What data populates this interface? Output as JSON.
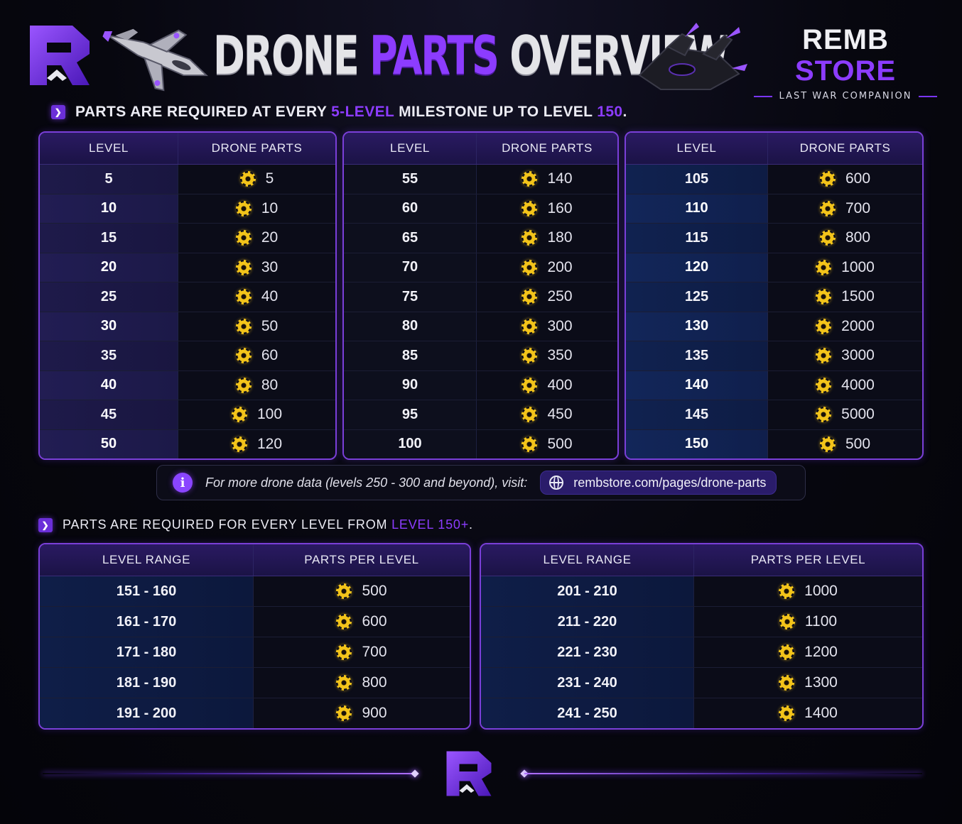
{
  "header": {
    "title_part1": "DRONE ",
    "title_part2": "PARTS",
    "title_part3": " OVERVIEW",
    "brand_part1": "REMB ",
    "brand_part2": "STORE",
    "brand_sub": "LAST WAR COMPANION"
  },
  "section1": {
    "text_a": "PARTS ARE REQUIRED AT EVERY ",
    "text_b": "5-LEVEL",
    "text_c": " MILESTONE UP TO LEVEL ",
    "text_d": "150",
    "text_e": "."
  },
  "milestone_tables": {
    "col_level": "LEVEL",
    "col_parts": "DRONE PARTS",
    "tables": [
      {
        "rows": [
          [
            "5",
            "5"
          ],
          [
            "10",
            "10"
          ],
          [
            "15",
            "20"
          ],
          [
            "20",
            "30"
          ],
          [
            "25",
            "40"
          ],
          [
            "30",
            "50"
          ],
          [
            "35",
            "60"
          ],
          [
            "40",
            "80"
          ],
          [
            "45",
            "100"
          ],
          [
            "50",
            "120"
          ]
        ]
      },
      {
        "rows": [
          [
            "55",
            "140"
          ],
          [
            "60",
            "160"
          ],
          [
            "65",
            "180"
          ],
          [
            "70",
            "200"
          ],
          [
            "75",
            "250"
          ],
          [
            "80",
            "300"
          ],
          [
            "85",
            "350"
          ],
          [
            "90",
            "400"
          ],
          [
            "95",
            "450"
          ],
          [
            "100",
            "500"
          ]
        ]
      },
      {
        "rows": [
          [
            "105",
            "600"
          ],
          [
            "110",
            "700"
          ],
          [
            "115",
            "800"
          ],
          [
            "120",
            "1000"
          ],
          [
            "125",
            "1500"
          ],
          [
            "130",
            "2000"
          ],
          [
            "135",
            "3000"
          ],
          [
            "140",
            "4000"
          ],
          [
            "145",
            "5000"
          ],
          [
            "150",
            "500"
          ]
        ]
      }
    ]
  },
  "info": {
    "text": "For more drone data (levels 250 - 300 and beyond), visit:",
    "link": "rembstore.com/pages/drone-parts"
  },
  "section2": {
    "text_a": "PARTS ARE REQUIRED FOR EVERY LEVEL FROM ",
    "text_b": "LEVEL 150+",
    "text_c": "."
  },
  "range_tables": {
    "col_range": "LEVEL RANGE",
    "col_parts": "PARTS PER LEVEL",
    "tables": [
      {
        "rows": [
          [
            "151 - 160",
            "500"
          ],
          [
            "161 - 170",
            "600"
          ],
          [
            "171 - 180",
            "700"
          ],
          [
            "181 - 190",
            "800"
          ],
          [
            "191 - 200",
            "900"
          ]
        ]
      },
      {
        "rows": [
          [
            "201 - 210",
            "1000"
          ],
          [
            "211 - 220",
            "1100"
          ],
          [
            "221 - 230",
            "1200"
          ],
          [
            "231 - 240",
            "1300"
          ],
          [
            "241 - 250",
            "1400"
          ]
        ]
      }
    ]
  },
  "icons": {
    "logo": "remb-r-logo-icon",
    "jet_left": "fighter-jet-icon",
    "jet_right": "drone-ship-icon",
    "gear": "gear-icon",
    "info": "info-icon",
    "globe": "globe-icon",
    "chevron": "chevron-right-icon"
  },
  "colors": {
    "accent": "#8c3cff",
    "gear": "#f3c41a",
    "border": "#7a3fd8"
  }
}
